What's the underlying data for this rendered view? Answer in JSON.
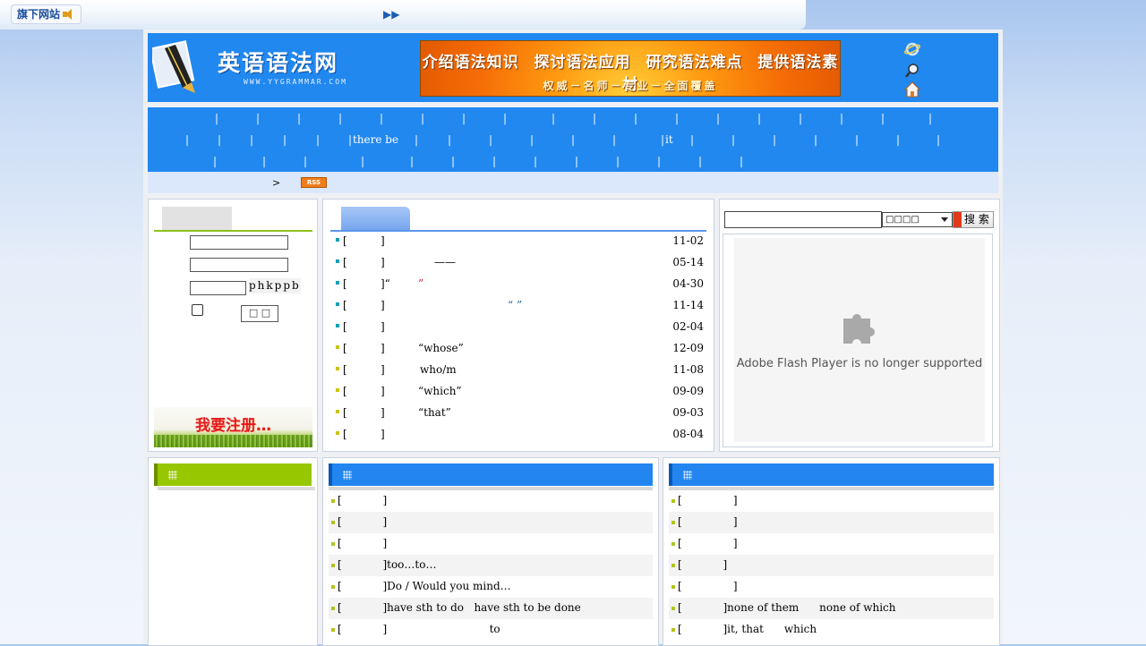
{
  "topbar": {
    "sister_sites": "旗下网站",
    "arrows": "▶▶"
  },
  "header": {
    "site_name": "英语语法网",
    "site_url": "WWW.YYGRAMMAR.COM",
    "banner_line1": "介绍语法知识 探讨语法应用 研究语法难点 提供语法素材",
    "banner_line2": "权威－名师－专业－全面覆盖"
  },
  "nav": {
    "there_be": "there be",
    "it": "it"
  },
  "breadcrumb": {
    "separator": ">",
    "rss": "RSS"
  },
  "login": {
    "captcha": "phkppb",
    "submit": "□ □",
    "register": "我要注册…"
  },
  "news": {
    "items": [
      {
        "bracket_open": "[",
        "bracket_close": "]",
        "title": "",
        "date": "11-02",
        "bullet": "teal"
      },
      {
        "bracket_open": "[",
        "bracket_close": "]",
        "title": "——",
        "date": "05-14",
        "bullet": "teal"
      },
      {
        "bracket_open": "[",
        "bracket_close": "]“",
        "title": "”",
        "date": "04-30",
        "bullet": "teal"
      },
      {
        "bracket_open": "[",
        "bracket_close": "]",
        "title": "“    ”",
        "date": "11-14",
        "bullet": "teal"
      },
      {
        "bracket_open": "[",
        "bracket_close": "]",
        "title": "",
        "date": "02-04",
        "bullet": "teal"
      },
      {
        "bracket_open": "[",
        "bracket_close": "]",
        "title": "“whose”",
        "date": "12-09",
        "bullet": "olive"
      },
      {
        "bracket_open": "[",
        "bracket_close": "]",
        "title": "who/m",
        "date": "11-08",
        "bullet": "olive"
      },
      {
        "bracket_open": "[",
        "bracket_close": "]",
        "title": "“which”",
        "date": "09-09",
        "bullet": "olive"
      },
      {
        "bracket_open": "[",
        "bracket_close": "]",
        "title": "“that”",
        "date": "09-03",
        "bullet": "olive"
      },
      {
        "bracket_open": "[",
        "bracket_close": "]",
        "title": "",
        "date": "08-04",
        "bullet": "olive"
      }
    ]
  },
  "search": {
    "select_value": "□□□□",
    "button": "搜 索",
    "flash_message": "Adobe Flash Player is no longer supported"
  },
  "lower_middle": {
    "items": [
      "[            ]",
      "[            ]",
      "[            ]",
      "[            ]too…to…",
      "[            ]Do / Would you mind…",
      "[            ]have sth to do   have sth to be done",
      "[            ]                              to"
    ]
  },
  "lower_right": {
    "items": [
      "[               ]",
      "[               ]",
      "[               ]",
      "[            ]",
      "[               ]",
      "[            ]none of them      none of which",
      "[            ]it, that      which"
    ]
  },
  "colors": {
    "header_blue": "#2188f0",
    "green": "#97c700",
    "banner_orange": "#f56d06"
  }
}
